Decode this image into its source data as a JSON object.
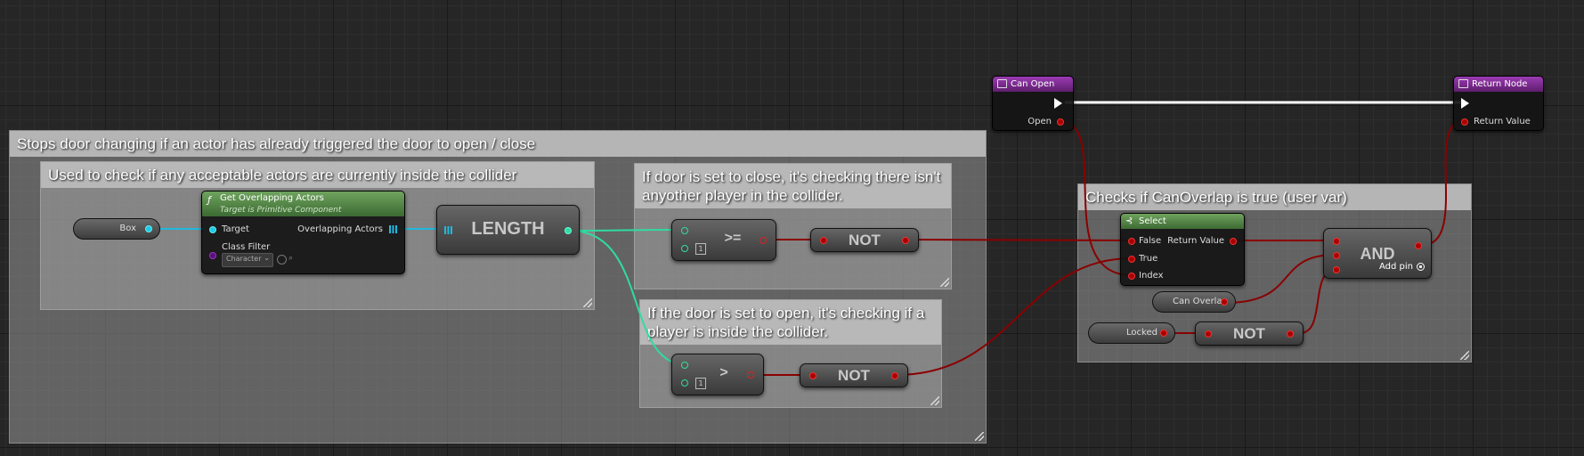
{
  "comments": {
    "outer": "Stops door changing if an actor has already triggered the door to open / close",
    "inner_overlap": "Used to check if any acceptable actors are currently inside the collider",
    "close": "If door is set to close, it's checking there isn't anyother player in the collider.",
    "open": "If the door is set to open, it's checking if a player is inside the collider.",
    "canoverlap": "Checks if CanOverlap is true (user var)"
  },
  "nodes": {
    "box": {
      "label": "Box"
    },
    "get_overlapping": {
      "title": "Get Overlapping Actors",
      "subtitle": "Target is Primitive Component",
      "target": "Target",
      "class_filter": "Class Filter",
      "class_value": "Character",
      "out": "Overlapping Actors"
    },
    "length": {
      "label": "LENGTH"
    },
    "ge": {
      "op": ">=",
      "value": "1"
    },
    "gt": {
      "op": ">",
      "value": "1"
    },
    "not1": {
      "label": "NOT"
    },
    "not2": {
      "label": "NOT"
    },
    "not3": {
      "label": "NOT"
    },
    "can_open": {
      "title": "Can Open",
      "out": "Open"
    },
    "return_node": {
      "title": "Return Node",
      "in": "Return Value"
    },
    "select": {
      "title": "Select",
      "false": "False",
      "true": "True",
      "index": "Index",
      "out": "Return Value"
    },
    "and": {
      "label": "AND",
      "add_pin": "Add pin"
    },
    "can_overlap": {
      "label": "Can Overlap"
    },
    "locked": {
      "label": "Locked"
    }
  },
  "colors": {
    "bool_wire": "#8a0000",
    "exec_wire": "#ffffff",
    "object_wire": "#1fb9e0",
    "int_wire": "#2fdca0",
    "function_header": "#5b8f4e",
    "event_header": "#7b2b8f"
  }
}
